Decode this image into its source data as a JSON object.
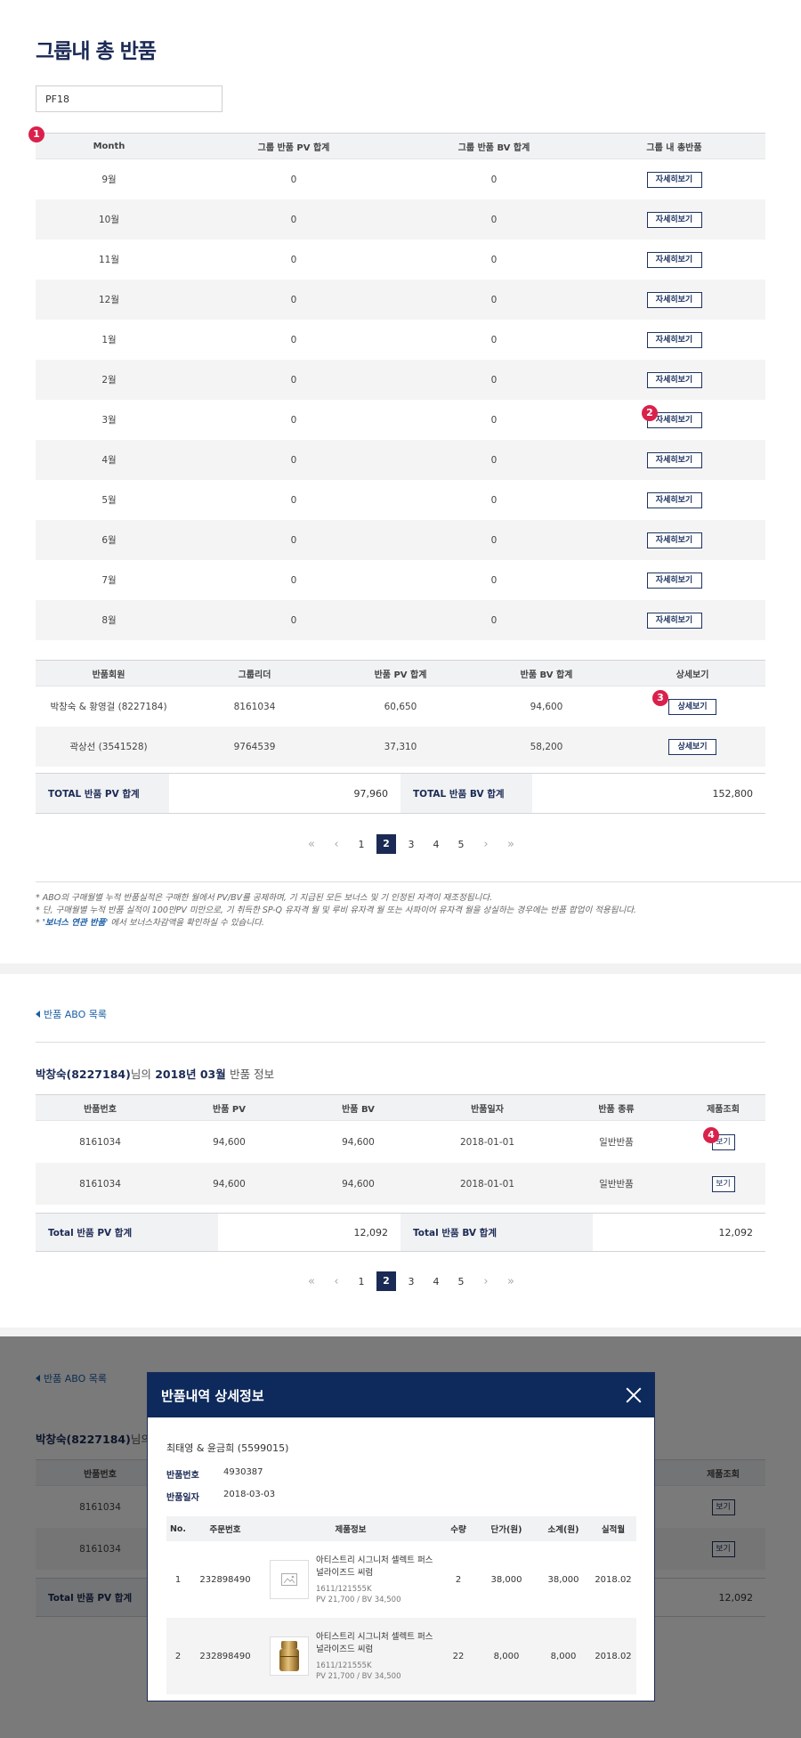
{
  "page_title": "그룹내 총 반품",
  "search": {
    "value": "PF18"
  },
  "monthly_table": {
    "headers": [
      "Month",
      "그룹 반품 PV 합계",
      "그룹 반품 BV 합계",
      "그룹 내 총반품"
    ],
    "rows": [
      {
        "month": "9월",
        "pv": "0",
        "bv": "0",
        "action": "자세히보기"
      },
      {
        "month": "10월",
        "pv": "0",
        "bv": "0",
        "action": "자세히보기"
      },
      {
        "month": "11월",
        "pv": "0",
        "bv": "0",
        "action": "자세히보기"
      },
      {
        "month": "12월",
        "pv": "0",
        "bv": "0",
        "action": "자세히보기"
      },
      {
        "month": "1월",
        "pv": "0",
        "bv": "0",
        "action": "자세히보기"
      },
      {
        "month": "2월",
        "pv": "0",
        "bv": "0",
        "action": "자세히보기"
      },
      {
        "month": "3월",
        "pv": "0",
        "bv": "0",
        "action": "자세히보기"
      },
      {
        "month": "4월",
        "pv": "0",
        "bv": "0",
        "action": "자세히보기"
      },
      {
        "month": "5월",
        "pv": "0",
        "bv": "0",
        "action": "자세히보기"
      },
      {
        "month": "6월",
        "pv": "0",
        "bv": "0",
        "action": "자세히보기"
      },
      {
        "month": "7월",
        "pv": "0",
        "bv": "0",
        "action": "자세히보기"
      },
      {
        "month": "8월",
        "pv": "0",
        "bv": "0",
        "action": "자세히보기"
      }
    ]
  },
  "markers": [
    "1",
    "2",
    "3",
    "4"
  ],
  "member_table": {
    "headers": [
      "반품회원",
      "그룹리더",
      "반품 PV 합계",
      "반품 BV 합계",
      "상세보기"
    ],
    "rows": [
      {
        "member": "박창숙 & 황영걸 (8227184)",
        "leader": "8161034",
        "pv": "60,650",
        "bv": "94,600",
        "action": "상세보기"
      },
      {
        "member": "곽상선 (3541528)",
        "leader": "9764539",
        "pv": "37,310",
        "bv": "58,200",
        "action": "상세보기"
      }
    ],
    "total_pv_label": "TOTAL 반품 PV 합계",
    "total_pv": "97,960",
    "total_bv_label": "TOTAL 반품 BV 합계",
    "total_bv": "152,800"
  },
  "pagination": {
    "first": "«",
    "prev": "‹",
    "pages": [
      "1",
      "2",
      "3",
      "4",
      "5"
    ],
    "current": "2",
    "next": "›",
    "last": "»"
  },
  "notes": [
    "* ABO의 구매월별 누적 반품실적은 구매한 월에서 PV/BV를 공제하며, 기 지급된 모든 보너스 및 기 인정된 자격이 재조정됩니다.",
    "* 단, 구매월별 누적 반품 실적이 100만PV 미만으로, 기 취득한 SP-Q 유자격 월 및 루비 유자격 월 또는 사파이어 유자격 월을 상실하는 경우에는 반품 합업이 적용됩니다.",
    "'보너스 연관 반품'",
    " 에서 보너스차감액을 확인하실 수 있습니다."
  ],
  "detail_section": {
    "back_label": "반품 ABO 목록",
    "title_name": "박창숙(8227184)",
    "title_mid": "님의",
    "title_period": "2018년 03월",
    "title_tail": "반품 정보",
    "headers": [
      "반품번호",
      "반품 PV",
      "반품 BV",
      "반품일자",
      "반품 종류",
      "제품조회"
    ],
    "rows": [
      {
        "no": "8161034",
        "pv": "94,600",
        "bv": "94,600",
        "date": "2018-01-01",
        "type": "일반반품",
        "action": "보기"
      },
      {
        "no": "8161034",
        "pv": "94,600",
        "bv": "94,600",
        "date": "2018-01-01",
        "type": "일반반품",
        "action": "보기"
      }
    ],
    "total_pv_label": "Total 반품 PV 합계",
    "total_pv": "12,092",
    "total_bv_label": "Total 반품 BV 합계",
    "total_bv": "12,092"
  },
  "modal": {
    "title": "반품내역 상세정보",
    "member": "최태영 & 윤금희 (5599015)",
    "return_no_label": "반품번호",
    "return_no": "4930387",
    "return_date_label": "반품일자",
    "return_date": "2018-03-03",
    "headers": [
      "No.",
      "주문번호",
      "제품정보",
      "수량",
      "단가(원)",
      "소계(원)",
      "실적월"
    ],
    "items": [
      {
        "no": "1",
        "order": "232898490",
        "name": "아티스트리 시그니처 셀렉트 퍼스널라이즈드 씨럼",
        "code": "1611/121555K",
        "pvbv": "PV 21,700 / BV 34,500",
        "qty": "2",
        "price": "38,000",
        "subtotal": "38,000",
        "month": "2018.02",
        "thumb": "image-placeholder-icon"
      },
      {
        "no": "2",
        "order": "232898490",
        "name": "아티스트리 시그니처 셀렉트 퍼스널라이즈드 씨럼",
        "code": "1611/121555K",
        "pvbv": "PV 21,700 / BV 34,500",
        "qty": "22",
        "price": "8,000",
        "subtotal": "8,000",
        "month": "2018.02",
        "thumb": "gold-bottle-icon"
      }
    ]
  },
  "colors": {
    "navy": "#1b2a55",
    "accent_red": "#d9214b",
    "link_blue": "#1b5fa5"
  }
}
